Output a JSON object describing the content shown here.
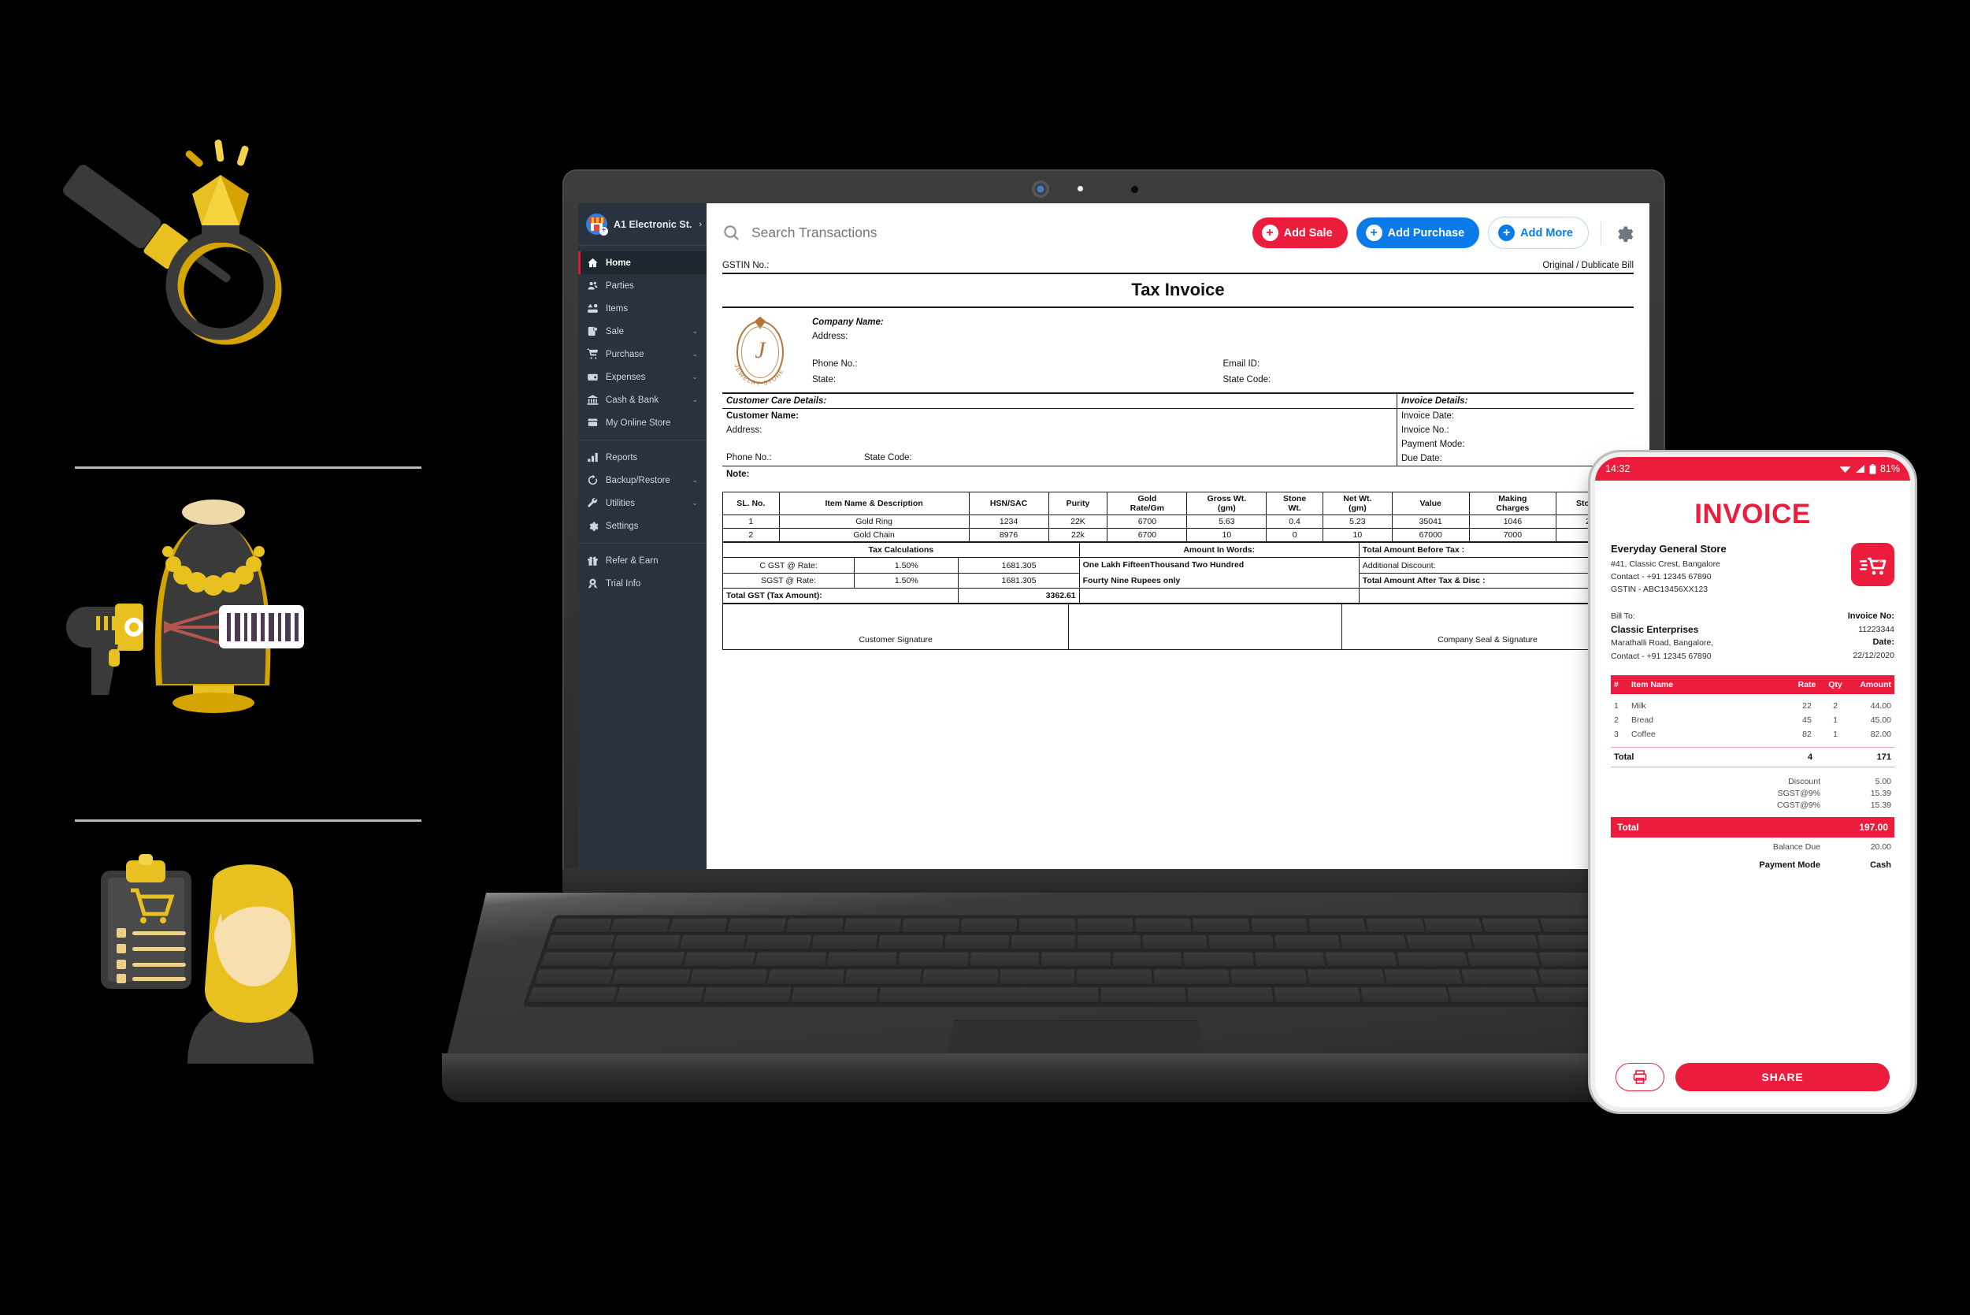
{
  "app": {
    "store_name": "A1 Electronic St.",
    "store_logo_icon": "storefront-icon",
    "chevron_right": "›",
    "nav_groups": [
      {
        "items": [
          {
            "label": "Home",
            "icon": "home-icon",
            "active": true,
            "caret": ""
          },
          {
            "label": "Parties",
            "icon": "people-icon",
            "active": false,
            "caret": ""
          },
          {
            "label": "Items",
            "icon": "items-icon",
            "active": false,
            "caret": ""
          },
          {
            "label": "Sale",
            "icon": "sale-doc-icon",
            "active": false,
            "caret": "⌄"
          },
          {
            "label": "Purchase",
            "icon": "cart-icon",
            "active": false,
            "caret": "⌄"
          },
          {
            "label": "Expenses",
            "icon": "wallet-icon",
            "active": false,
            "caret": "⌄"
          },
          {
            "label": "Cash & Bank",
            "icon": "bank-icon",
            "active": false,
            "caret": "⌄"
          },
          {
            "label": "My Online Store",
            "icon": "online-store-icon",
            "active": false,
            "caret": ""
          }
        ]
      },
      {
        "items": [
          {
            "label": "Reports",
            "icon": "bar-chart-icon",
            "active": false,
            "caret": ""
          },
          {
            "label": "Backup/Restore",
            "icon": "restore-icon",
            "active": false,
            "caret": "⌄"
          },
          {
            "label": "Utilities",
            "icon": "wrench-icon",
            "active": false,
            "caret": "⌄"
          },
          {
            "label": "Settings",
            "icon": "gear-icon",
            "active": false,
            "caret": ""
          }
        ]
      },
      {
        "items": [
          {
            "label": "Refer & Earn",
            "icon": "gift-icon",
            "active": false,
            "caret": ""
          },
          {
            "label": "Trial Info",
            "icon": "badge-icon",
            "active": false,
            "caret": ""
          }
        ]
      }
    ],
    "toolbar": {
      "search_placeholder": "Search Transactions",
      "search_value": "",
      "search_icon": "search-icon",
      "add_sale_label": "Add Sale",
      "add_purchase_label": "Add Purchase",
      "add_more_label": "Add More",
      "plus_glyph": "+",
      "settings_icon": "gear-icon"
    }
  },
  "invoice": {
    "gstin_label": "GSTIN No.:",
    "bill_copy_label": "Original / Dublicate Bill",
    "title": "Tax Invoice",
    "logo_letter": "J",
    "logo_caption": "JEWELRY STORE",
    "company": {
      "name_label": "Company Name:",
      "address_label": "Address:",
      "phone_label": "Phone No.:",
      "email_label": "Email ID:",
      "state_label": "State:",
      "state_code_label": "State Code:"
    },
    "customer": {
      "section_title": "Customer Care Details:",
      "name_label": "Customer Name:",
      "address_label": "Address:",
      "phone_label": "Phone No.:",
      "state_code_label": "State Code:"
    },
    "invoice_details": {
      "section_title": "Invoice Details:",
      "date_label": "Invoice Date:",
      "no_label": "Invoice No.:",
      "payment_mode_label": "Payment Mode:",
      "due_date_label": "Due Date:"
    },
    "note_label": "Note:",
    "table": {
      "headers": [
        "SL. No.",
        "Item Name & Description",
        "HSN/SAC",
        "Purity",
        "Gold Rate/Gm",
        "Gross Wt. (gm)",
        "Stone Wt.",
        "Net Wt. (gm)",
        "Value",
        "Making Charges",
        "Stone Val"
      ],
      "header_lines": [
        [
          "SL. No."
        ],
        [
          "Item Name & Description"
        ],
        [
          "HSN/SAC"
        ],
        [
          "Purity"
        ],
        [
          "Gold",
          "Rate/Gm"
        ],
        [
          "Gross Wt.",
          "(gm)"
        ],
        [
          "Stone",
          "Wt."
        ],
        [
          "Net Wt.",
          "(gm)"
        ],
        [
          "Value"
        ],
        [
          "Making",
          "Charges"
        ],
        [
          "Stone Val"
        ]
      ],
      "rows": [
        [
          "1",
          "Gold Ring",
          "1234",
          "22K",
          "6700",
          "5.63",
          "0.4",
          "5.23",
          "35041",
          "1046",
          "2000"
        ],
        [
          "2",
          "Gold Chain",
          "8976",
          "22k",
          "6700",
          "10",
          "0",
          "10",
          "67000",
          "7000",
          ""
        ]
      ]
    },
    "tax": {
      "section_title": "Tax Calculations",
      "cgst_label": "C GST @ Rate:",
      "cgst_rate": "1.50%",
      "cgst_amount": "1681.305",
      "sgst_label": "SGST @ Rate:",
      "sgst_rate": "1.50%",
      "sgst_amount": "1681.305",
      "total_gst_label": "Total GST (Tax Amount):",
      "total_gst_amount": "3362.61"
    },
    "words": {
      "title": "Amount In Words:",
      "line1": "One Lakh FifteenThousand Two Hundred",
      "line2": "Fourty Nine Rupees only"
    },
    "totals": {
      "before_tax_label": "Total Amount Before Tax :",
      "discount_label": "Additional Discount:",
      "after_tax_label": "Total Amount After Tax & Disc :"
    },
    "signatures": {
      "customer": "Customer Signature",
      "company": "Company Seal & Signature"
    }
  },
  "phone": {
    "status": {
      "time": "14:32",
      "wifi_icon": "wifi-icon",
      "signal_icon": "signal-icon",
      "battery_icon": "battery-icon",
      "battery": "81%"
    },
    "title": "INVOICE",
    "logo_icon": "cart-logo-icon",
    "store": {
      "name": "Everyday General Store",
      "address": "#41, Classic Crest, Bangalore",
      "contact": "Contact - +91 12345 67890",
      "gstin": "GSTIN - ABC13456XX123"
    },
    "bill_to": {
      "label": "Bill To:",
      "name": "Classic Enterprises",
      "address": "Marathalli Road, Bangalore,",
      "contact": "Contact - +91 12345 67890"
    },
    "meta": {
      "invoice_no_label": "Invoice No:",
      "invoice_no": "11223344",
      "date_label": "Date:",
      "date": "22/12/2020"
    },
    "table": {
      "headers": [
        "#",
        "Item Name",
        "Rate",
        "Qty",
        "Amount"
      ],
      "rows": [
        [
          "1",
          "Milk",
          "22",
          "2",
          "44.00"
        ],
        [
          "2",
          "Bread",
          "45",
          "1",
          "45.00"
        ],
        [
          "3",
          "Coffee",
          "82",
          "1",
          "82.00"
        ]
      ],
      "total_label": "Total",
      "total_qty": "4",
      "total_amount": "171"
    },
    "summary": [
      {
        "label": "Discount",
        "value": "5.00"
      },
      {
        "label": "SGST@9%",
        "value": "15.39"
      },
      {
        "label": "CGST@9%",
        "value": "15.39"
      }
    ],
    "grand_total": {
      "label": "Total",
      "value": "197.00"
    },
    "balance_due": {
      "label": "Balance Due",
      "value": "20.00"
    },
    "payment_mode": {
      "label": "Payment Mode",
      "value": "Cash"
    },
    "actions": {
      "print_icon": "printer-icon",
      "share_label": "SHARE"
    }
  },
  "illustrations": [
    {
      "name": "magnifier-ring-illustration"
    },
    {
      "name": "barcode-scanner-necklace-illustration"
    },
    {
      "name": "clipboard-customer-illustration"
    }
  ],
  "colors": {
    "brand_red": "#ec1c3d",
    "brand_blue": "#0b7bea",
    "sidebar_bg": "#29323d",
    "gold": "#e8c01f",
    "logo_copper": "#b5743e"
  }
}
